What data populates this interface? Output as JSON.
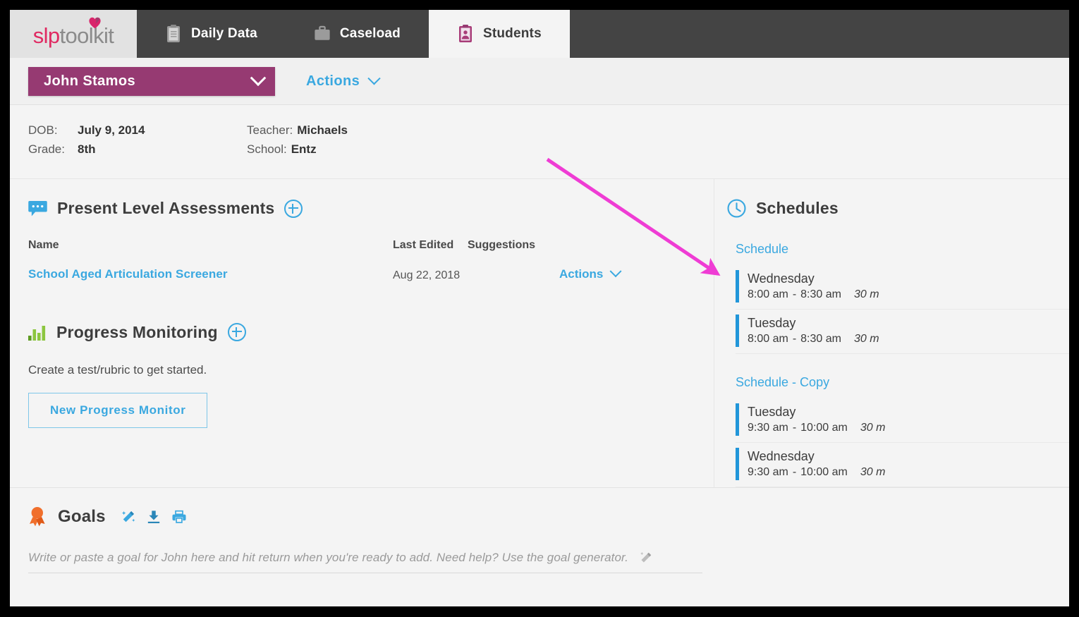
{
  "colors": {
    "brand_magenta": "#963a72",
    "logo_pink": "#e02a62",
    "link_blue": "#3aa8e0",
    "schedule_bar_blue": "#2196d9",
    "nav_dark": "#444444",
    "goals_orange": "#f06f2c",
    "progress_green": "#8cc63f",
    "annotation_pink": "#ef3cd4"
  },
  "logo": {
    "part1": "slp",
    "part2": "toolkit",
    "heart_icon": "heart-icon"
  },
  "nav": {
    "tabs": [
      {
        "label": "Daily Data",
        "icon": "clipboard-icon",
        "active": false
      },
      {
        "label": "Caseload",
        "icon": "briefcase-icon",
        "active": false
      },
      {
        "label": "Students",
        "icon": "id-badge-icon",
        "active": true
      }
    ]
  },
  "student_bar": {
    "selected_student": "John Stamos",
    "dropdown_icon": "chevron-down-icon",
    "actions_label": "Actions"
  },
  "student_info": {
    "dob_label": "DOB:",
    "dob_value": "July 9, 2014",
    "grade_label": "Grade:",
    "grade_value": "8th",
    "teacher_label": "Teacher:",
    "teacher_value": "Michaels",
    "school_label": "School:",
    "school_value": "Entz"
  },
  "present_level": {
    "title": "Present Level Assessments",
    "icon": "speech-bubble-icon",
    "add_icon": "plus-circle-icon",
    "columns": {
      "name": "Name",
      "last_edited": "Last Edited",
      "suggestions": "Suggestions"
    },
    "rows": [
      {
        "name": "School Aged Articulation Screener",
        "last_edited": "Aug 22, 2018",
        "suggestions": "",
        "actions_label": "Actions"
      }
    ]
  },
  "progress_monitoring": {
    "title": "Progress Monitoring",
    "icon": "bar-chart-icon",
    "add_icon": "plus-circle-icon",
    "empty_note": "Create a test/rubric to get started.",
    "new_button": "New Progress Monitor"
  },
  "schedules": {
    "title": "Schedules",
    "icon": "clock-icon",
    "groups": [
      {
        "name": "Schedule",
        "items": [
          {
            "day": "Wednesday",
            "start": "8:00 am",
            "sep": "-",
            "end": "8:30 am",
            "duration": "30 m"
          },
          {
            "day": "Tuesday",
            "start": "8:00 am",
            "sep": "-",
            "end": "8:30 am",
            "duration": "30 m"
          }
        ]
      },
      {
        "name": "Schedule - Copy",
        "items": [
          {
            "day": "Tuesday",
            "start": "9:30 am",
            "sep": "-",
            "end": "10:00 am",
            "duration": "30 m"
          },
          {
            "day": "Wednesday",
            "start": "9:30 am",
            "sep": "-",
            "end": "10:00 am",
            "duration": "30 m"
          }
        ]
      }
    ]
  },
  "goals": {
    "title": "Goals",
    "icon": "ribbon-award-icon",
    "tools": [
      {
        "icon": "magic-wand-icon"
      },
      {
        "icon": "download-icon"
      },
      {
        "icon": "print-icon"
      }
    ],
    "input_placeholder": "Write or paste a goal for John here and hit return when you're ready to add.   Need help? Use the goal generator.",
    "input_value": "",
    "input_wand_icon": "magic-wand-icon"
  },
  "annotation": {
    "arrow_icon": "pink-arrow-annotation"
  }
}
